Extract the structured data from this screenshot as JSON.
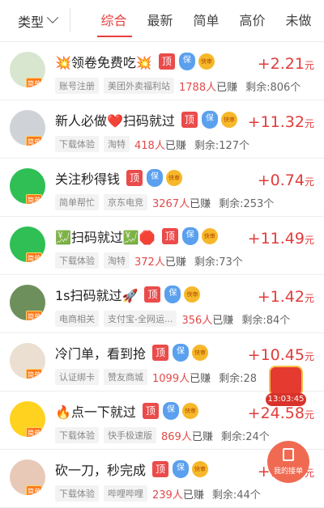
{
  "filter": {
    "type_label": "类型"
  },
  "tabs": [
    {
      "label": "综合"
    },
    {
      "label": "最新"
    },
    {
      "label": "简单"
    },
    {
      "label": "高价"
    },
    {
      "label": "未做"
    }
  ],
  "badges": {
    "ding": "顶",
    "bao": "保",
    "kuai": "快审",
    "avatar_tag": "简单"
  },
  "currency": "元",
  "rows": [
    {
      "title": "💥领卷免费吃💥",
      "cat": "账号注册",
      "platform": "美团外卖福利站",
      "earned": "1788人",
      "earned_suffix": "已赚",
      "remaining": "剩余:806个",
      "price": "+2.21",
      "avatar_color": "#d9e6cf"
    },
    {
      "title": "新人必做❤️扫码就过",
      "cat": "下载体验",
      "platform": "淘特",
      "earned": "418人",
      "earned_suffix": "已赚",
      "remaining": "剩余:127个",
      "price": "+11.32",
      "avatar_color": "#cfd3d8"
    },
    {
      "title": "关注秒得钱",
      "cat": "简单帮忙",
      "platform": "京东电竞",
      "earned": "3267人",
      "earned_suffix": "已赚",
      "remaining": "剩余:253个",
      "price": "+0.74",
      "avatar_color": "#2fbf55"
    },
    {
      "title": "💹扫码就过💹🛑",
      "cat": "下载体验",
      "platform": "淘特",
      "earned": "372人",
      "earned_suffix": "已赚",
      "remaining": "剩余:73个",
      "price": "+11.49",
      "avatar_color": "#2fbf55"
    },
    {
      "title": "1s扫码就过🚀",
      "cat": "电商相关",
      "platform": "支付宝-全网运...",
      "earned": "356人",
      "earned_suffix": "已赚",
      "remaining": "剩余:84个",
      "price": "+1.42",
      "avatar_color": "#6d8f5c"
    },
    {
      "title": "冷门单，看到抢",
      "cat": "认证绑卡",
      "platform": "赞友商城",
      "earned": "1099人",
      "earned_suffix": "已赚",
      "remaining": "剩余:28",
      "price": "+10.45",
      "avatar_color": "#eadfd0"
    },
    {
      "title": "🔥点一下就过",
      "cat": "下载体验",
      "platform": "快手极速版",
      "earned": "869人",
      "earned_suffix": "已赚",
      "remaining": "剩余:24个",
      "price": "+24.58",
      "avatar_color": "#ffd21f"
    },
    {
      "title": "砍一刀，秒完成",
      "cat": "下载体验",
      "platform": "哔哩哔哩",
      "earned": "239人",
      "earned_suffix": "已赚",
      "remaining": "剩余:44个",
      "price": "+1.42",
      "avatar_color": "#e8c9b8"
    }
  ],
  "widgets": {
    "hongbao_time": "13:03:45",
    "jiedan_label": "我的接单"
  }
}
